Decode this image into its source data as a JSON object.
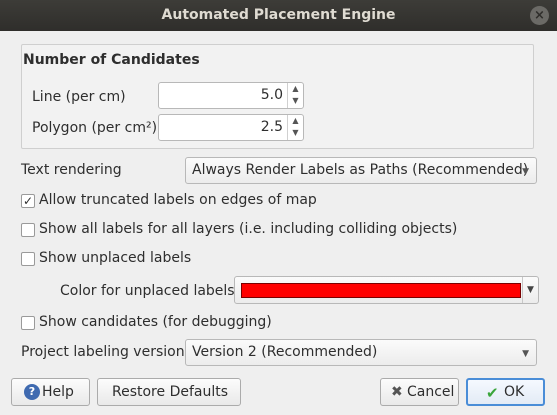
{
  "window": {
    "title": "Automated Placement Engine",
    "close_symbol": "×"
  },
  "candidates": {
    "title": "Number of Candidates",
    "line_label": "Line (per cm)",
    "line_value": "5.0",
    "polygon_label": "Polygon (per cm²)",
    "polygon_value": "2.5"
  },
  "text_rendering": {
    "label": "Text rendering",
    "selected": "Always Render Labels as Paths (Recommended)"
  },
  "options": {
    "allow_truncated": {
      "label": "Allow truncated labels on edges of map",
      "checked": true
    },
    "show_all_labels": {
      "label": "Show all labels for all layers (i.e. including colliding objects)",
      "checked": false
    },
    "show_unplaced": {
      "label": "Show unplaced labels",
      "checked": false
    },
    "show_candidates": {
      "label": "Show candidates (for debugging)",
      "checked": false
    }
  },
  "unplaced_color": {
    "label": "Color for unplaced labels",
    "color": "#ff0000"
  },
  "labeling_version": {
    "label": "Project labeling version",
    "selected": "Version 2 (Recommended)"
  },
  "buttons": {
    "help": "Help",
    "restore": "Restore Defaults",
    "cancel": "Cancel",
    "ok": "OK"
  },
  "icons": {
    "help": "help-icon",
    "cancel": "cancel-icon",
    "ok": "checkmark-icon",
    "check_mark": "✓"
  }
}
